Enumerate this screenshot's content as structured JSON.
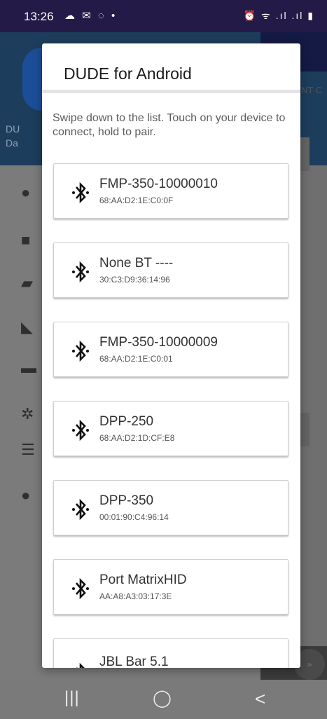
{
  "status_bar": {
    "time": "13:26",
    "left_icons": "☁ ✉ ◌ •",
    "right_icons": "⏰ ᯤ .ıl .ıl ▮"
  },
  "background_app": {
    "text_line1": "DU",
    "text_line2": "Da",
    "tab_fragment": "NT C"
  },
  "dialog": {
    "title": "DUDE for Android",
    "instructions": "Swipe down to the list. Touch on your device to connect, hold to pair.",
    "devices": [
      {
        "name": "FMP-350-10000010",
        "mac": "68:AA:D2:1E:C0:0F"
      },
      {
        "name": "None BT ----",
        "mac": "30:C3:D9:36:14:96"
      },
      {
        "name": "FMP-350-10000009",
        "mac": "68:AA:D2:1E:C0:01"
      },
      {
        "name": "DPP-250",
        "mac": "68:AA:D2:1D:CF:E8"
      },
      {
        "name": "DPP-350",
        "mac": "00:01:90:C4:96:14"
      },
      {
        "name": "Port MatrixHID",
        "mac": "AA:A8:A3:03:17:3E"
      },
      {
        "name": "JBL Bar 5.1",
        "mac": ""
      }
    ]
  },
  "nav_bar": {
    "recents": "|||",
    "home": "◯",
    "back": "<"
  },
  "icons": {
    "device_icon": "bluetooth-icon"
  }
}
